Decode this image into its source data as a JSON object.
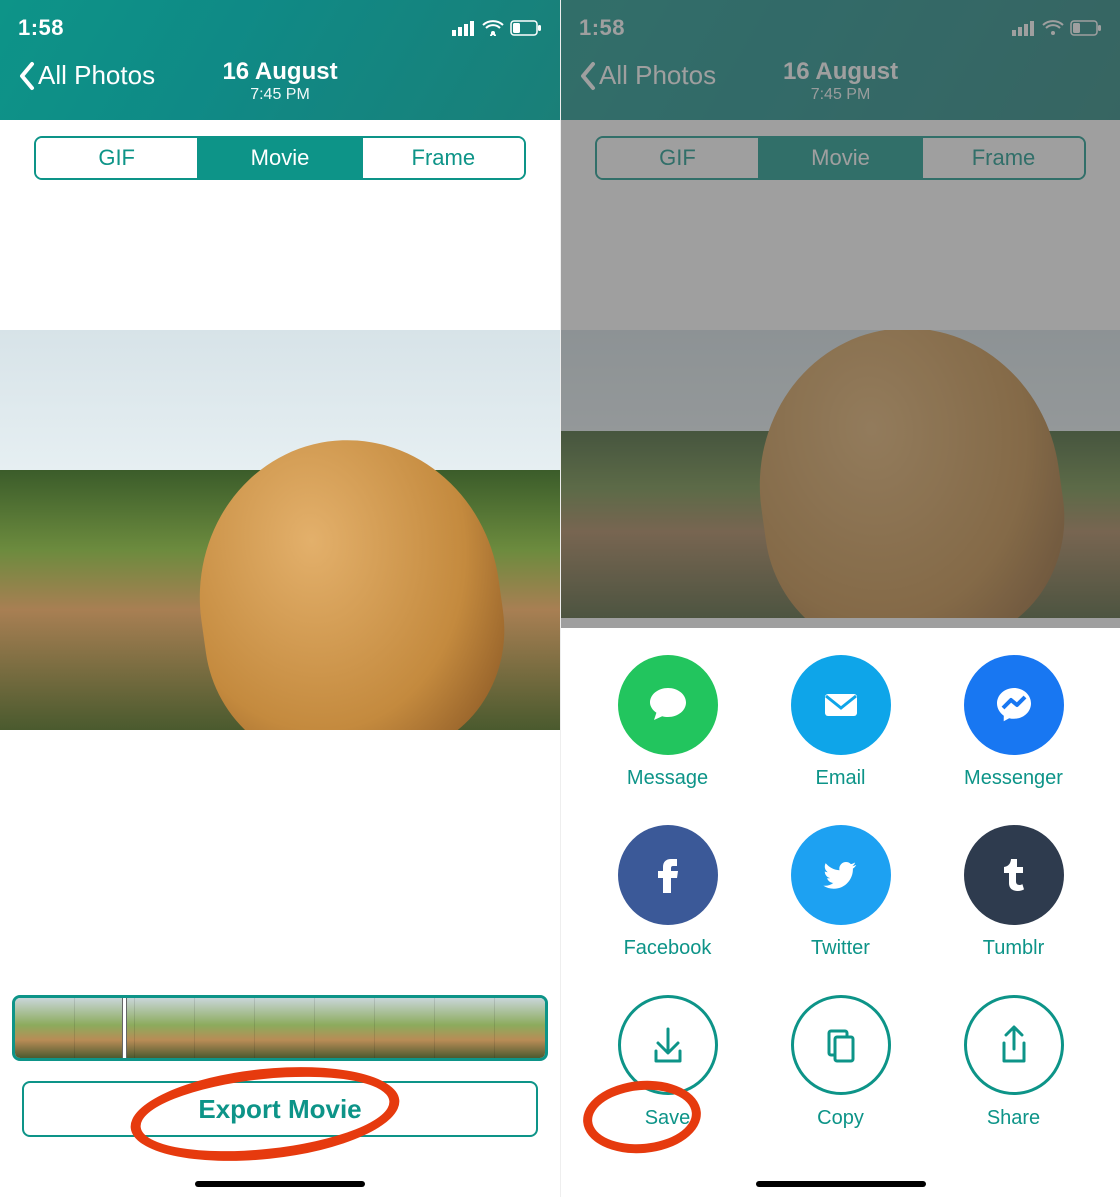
{
  "status": {
    "time": "1:58"
  },
  "header": {
    "back_label": "All Photos",
    "title": "16 August",
    "subtitle": "7:45 PM"
  },
  "segments": {
    "gif": "GIF",
    "movie": "Movie",
    "frame": "Frame",
    "active": "movie"
  },
  "export_button": "Export Movie",
  "share": {
    "message": "Message",
    "email": "Email",
    "messenger": "Messenger",
    "facebook": "Facebook",
    "twitter": "Twitter",
    "tumblr": "Tumblr",
    "save": "Save",
    "copy": "Copy",
    "share": "Share"
  }
}
